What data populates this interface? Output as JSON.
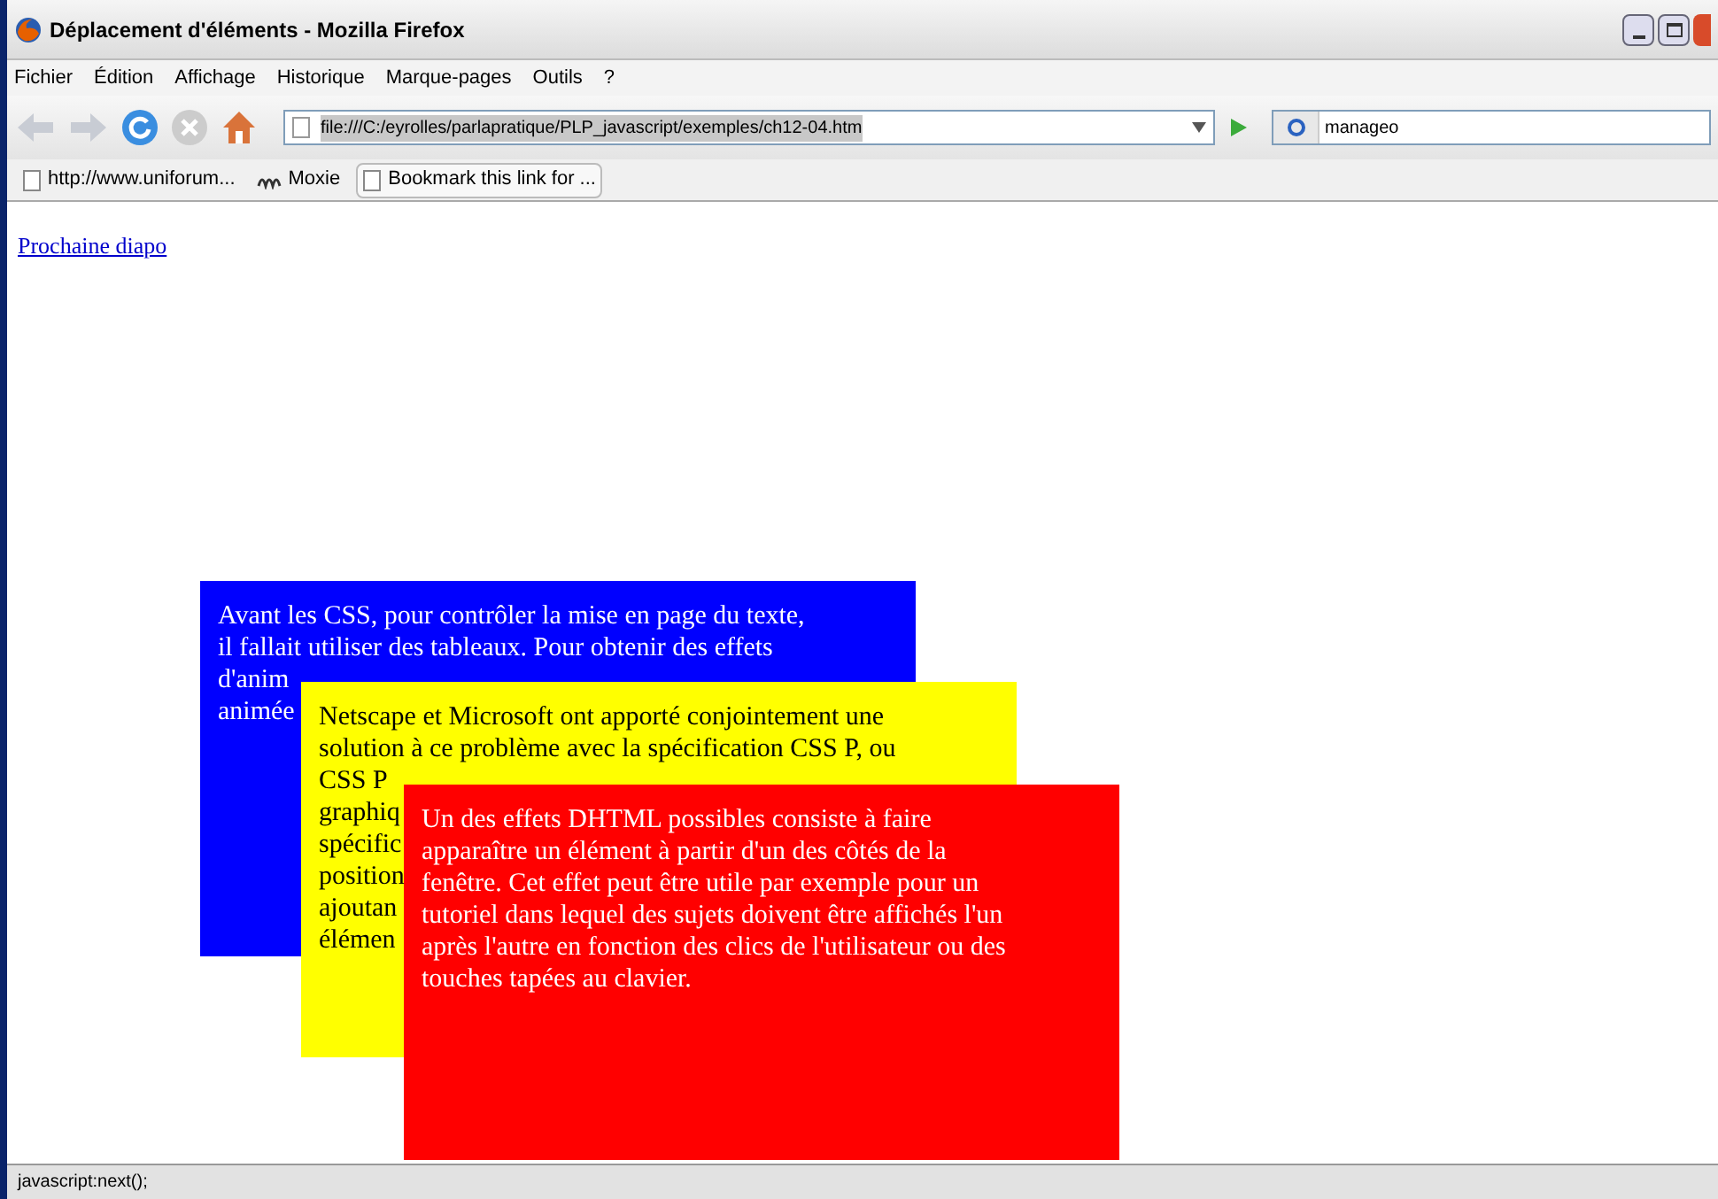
{
  "window": {
    "title": "Déplacement d'éléments - Mozilla Firefox"
  },
  "menu": [
    "Fichier",
    "Édition",
    "Affichage",
    "Historique",
    "Marque-pages",
    "Outils",
    "?"
  ],
  "address": {
    "value": "file:///C:/eyrolles/parlapratique/PLP_javascript/exemples/ch12-04.htm"
  },
  "search": {
    "value": "manageo"
  },
  "bookmarks": [
    {
      "label": "http://www.uniforum...",
      "kind": "page"
    },
    {
      "label": "Moxie",
      "kind": "dojo"
    },
    {
      "label": "Bookmark this link for ...",
      "kind": "button"
    }
  ],
  "link": "Prochaine diapo",
  "boxes": [
    {
      "color": "#0000ff",
      "lines": [
        "Avant les CSS, pour contrôler la mise en page du texte,",
        "il fallait utiliser des tableaux. Pour obtenir des effets",
        "d'anim",
        "animée"
      ]
    },
    {
      "color": "#ffff00",
      "lines": [
        "Netscape et Microsoft ont apporté conjointement une",
        "solution à ce problème avec la spécification CSS P, ou",
        "CSS P",
        "graphiq",
        "spécific",
        "position",
        "ajoutan",
        "élémen"
      ]
    },
    {
      "color": "#ff0000",
      "lines": [
        "Un des effets DHTML possibles consiste à faire",
        "apparaître un élément à partir d'un des côtés de la",
        "fenêtre. Cet effet peut être utile par exemple pour un",
        "tutoriel dans lequel des sujets doivent être affichés l'un",
        "après l'autre en fonction des clics de l'utilisateur ou des",
        "touches tapées au clavier."
      ]
    }
  ],
  "status_bar": "javascript:next();"
}
